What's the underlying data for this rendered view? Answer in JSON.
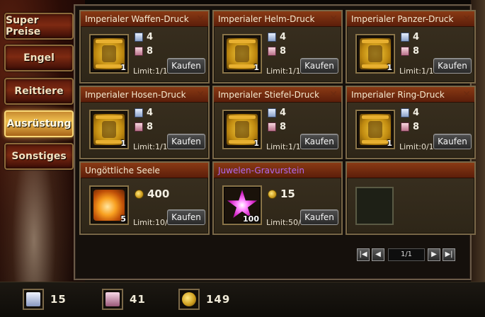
{
  "tabs": [
    {
      "label": "Super Preise",
      "active": false
    },
    {
      "label": "Engel",
      "active": false
    },
    {
      "label": "Reittiere",
      "active": false
    },
    {
      "label": "Ausrüstung",
      "active": true
    },
    {
      "label": "Sonstiges",
      "active": false
    }
  ],
  "items": [
    {
      "title": "Imperialer Waffen-Druck",
      "qty": "1",
      "cost_a": "4",
      "cost_b": "8",
      "limit": "Limit:1/1",
      "buy": "Kaufen",
      "icon": "weapon-scroll-icon"
    },
    {
      "title": "Imperialer Helm-Druck",
      "qty": "1",
      "cost_a": "4",
      "cost_b": "8",
      "limit": "Limit:1/1",
      "buy": "Kaufen",
      "icon": "helm-scroll-icon"
    },
    {
      "title": "Imperialer Panzer-Druck",
      "qty": "1",
      "cost_a": "4",
      "cost_b": "8",
      "limit": "Limit:1/1",
      "buy": "Kaufen",
      "icon": "armor-scroll-icon"
    },
    {
      "title": "Imperialer Hosen-Druck",
      "qty": "1",
      "cost_a": "4",
      "cost_b": "8",
      "limit": "Limit:1/1",
      "buy": "Kaufen",
      "icon": "pants-scroll-icon"
    },
    {
      "title": "Imperialer Stiefel-Druck",
      "qty": "1",
      "cost_a": "4",
      "cost_b": "8",
      "limit": "Limit:1/1",
      "buy": "Kaufen",
      "icon": "boots-scroll-icon"
    },
    {
      "title": "Imperialer Ring-Druck",
      "qty": "1",
      "cost_a": "4",
      "cost_b": "8",
      "limit": "Limit:0/1",
      "buy": "Kaufen",
      "icon": "ring-scroll-icon"
    },
    {
      "title": "Ungöttliche Seele",
      "qty": "5",
      "cost_gold": "400",
      "limit": "Limit:10/10",
      "buy": "Kaufen",
      "icon": "soul-icon"
    },
    {
      "title": "Juwelen-Gravurstein",
      "qty": "100",
      "cost_gold": "15",
      "limit": "Limit:50/50",
      "buy": "Kaufen",
      "icon": "gem-icon"
    }
  ],
  "pagination": {
    "info": "1/1",
    "first": "|◀",
    "prev": "◀",
    "next": "▶",
    "last": "▶|"
  },
  "currencies": [
    {
      "icon": "white-scroll-icon",
      "value": "15"
    },
    {
      "icon": "pink-scroll-icon",
      "value": "41"
    },
    {
      "icon": "gold-coin-icon",
      "value": "149"
    }
  ],
  "colors": {
    "accent_gold": "#f0c050",
    "header_red": "#8a3a14",
    "name_purple": "#b068f0"
  }
}
